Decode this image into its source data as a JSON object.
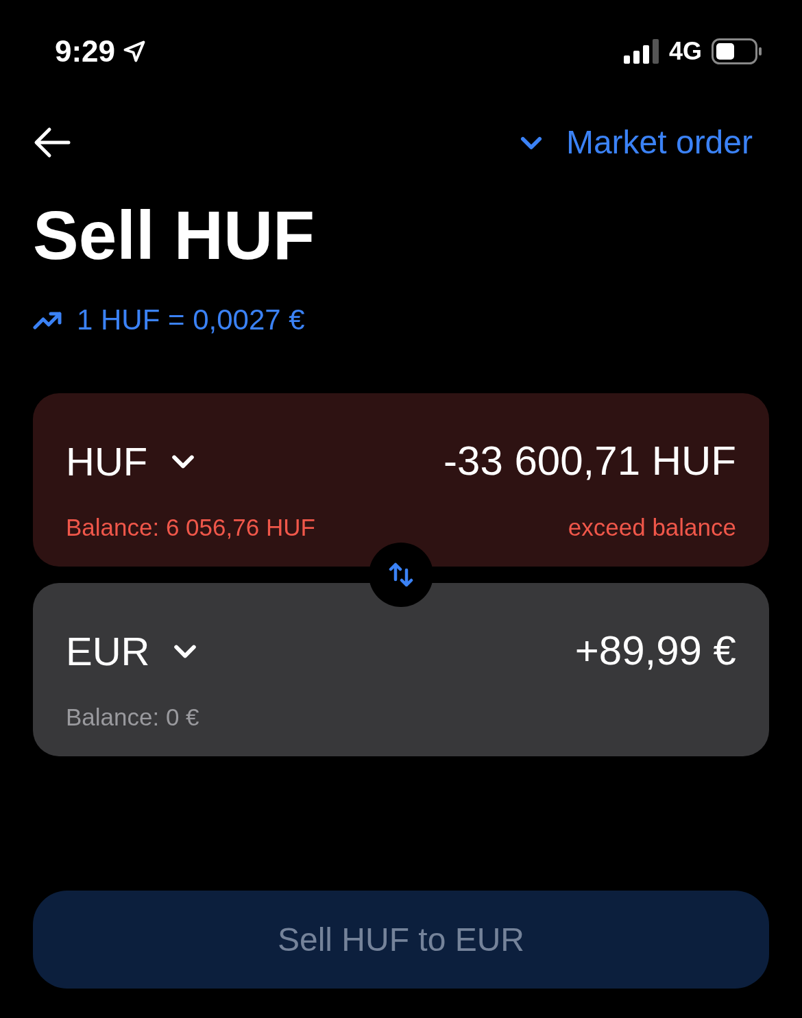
{
  "status_bar": {
    "time": "9:29",
    "network": "4G"
  },
  "header": {
    "order_type": "Market order"
  },
  "title": "Sell HUF",
  "rate": "1 HUF = 0,0027 €",
  "cards": [
    {
      "currency": "HUF",
      "amount": "-33 600,71 HUF",
      "balance": "Balance: 6 056,76 HUF",
      "error": true,
      "error_text": "exceed balance"
    },
    {
      "currency": "EUR",
      "amount": "+89,99 €",
      "balance": "Balance: 0 €",
      "error": false
    }
  ],
  "submit": {
    "label": "Sell HUF to EUR",
    "disabled": true
  }
}
